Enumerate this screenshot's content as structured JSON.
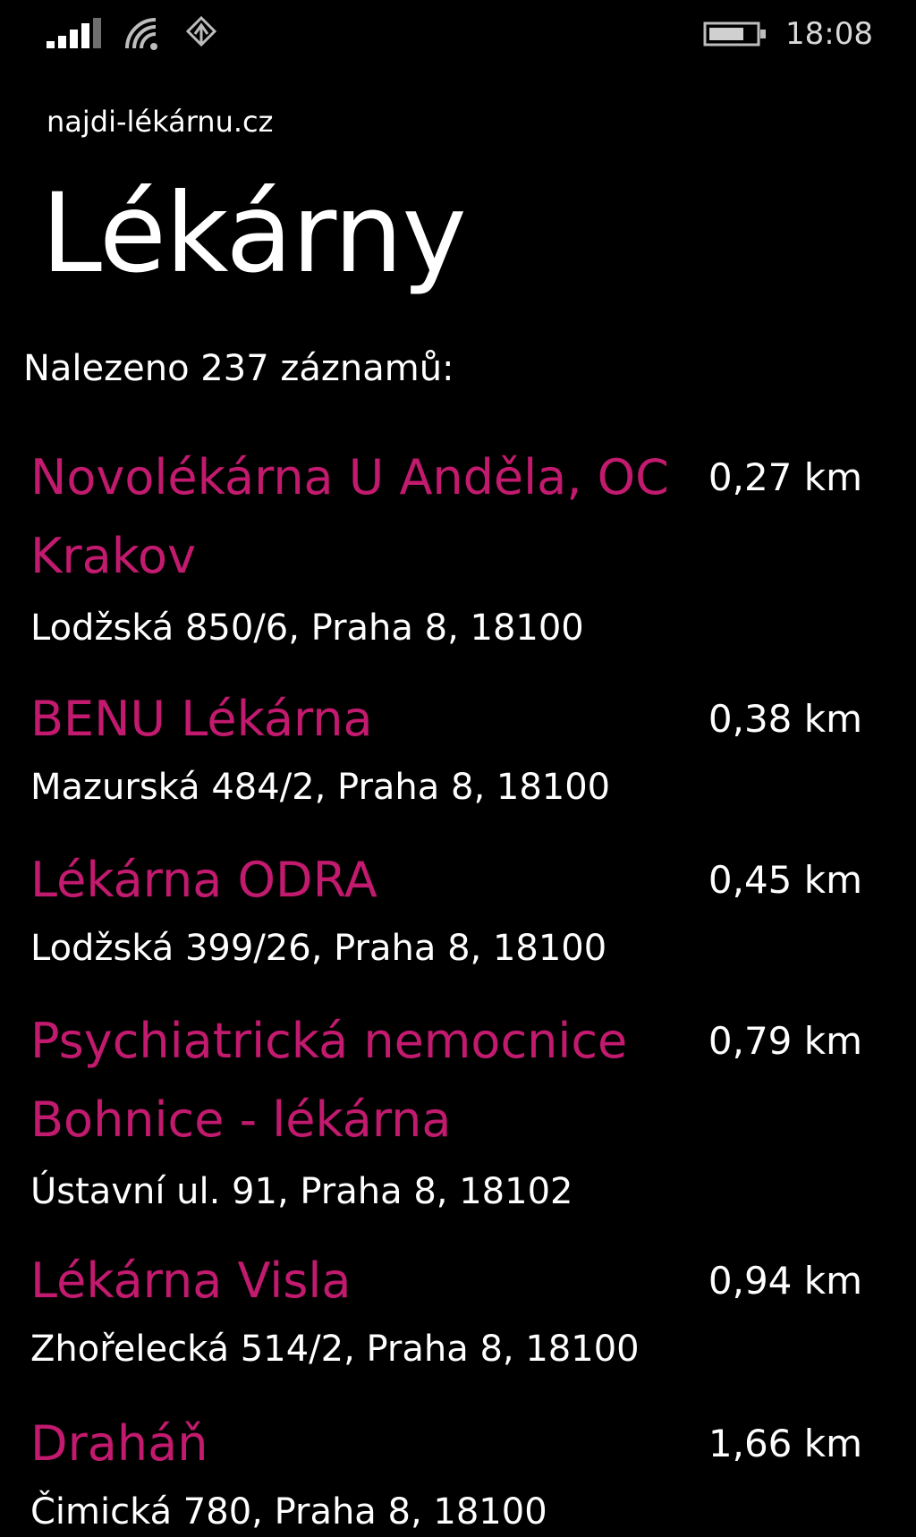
{
  "status_bar": {
    "time": "18:08",
    "icons": [
      "signal-icon",
      "wifi-icon",
      "data-icon",
      "battery-icon"
    ]
  },
  "app": {
    "name": "najdi-lékárnu.cz",
    "title": "Lékárny",
    "result_count": "Nalezeno 237 záznamů:"
  },
  "pharmacies": [
    {
      "name": "Novolékárna U Anděla, OC Krakov",
      "distance": "0,27 km",
      "address": "Lodžská 850/6, Praha 8, 18100"
    },
    {
      "name": "BENU Lékárna",
      "distance": "0,38 km",
      "address": "Mazurská 484/2, Praha 8, 18100"
    },
    {
      "name": "Lékárna ODRA",
      "distance": "0,45 km",
      "address": "Lodžská 399/26, Praha 8, 18100"
    },
    {
      "name": "Psychiatrická nemocnice Bohnice - lékárna",
      "distance": "0,79 km",
      "address": "Ústavní ul. 91, Praha 8, 18102"
    },
    {
      "name": "Lékárna Visla",
      "distance": "0,94 km",
      "address": "Zhořelecká 514/2, Praha 8, 18100"
    },
    {
      "name": "Draháň",
      "distance": "1,66 km",
      "address": "Čimická 780, Praha 8, 18100"
    }
  ],
  "colors": {
    "accent": "#c21a6e",
    "background": "#000000",
    "text": "#ffffff"
  }
}
